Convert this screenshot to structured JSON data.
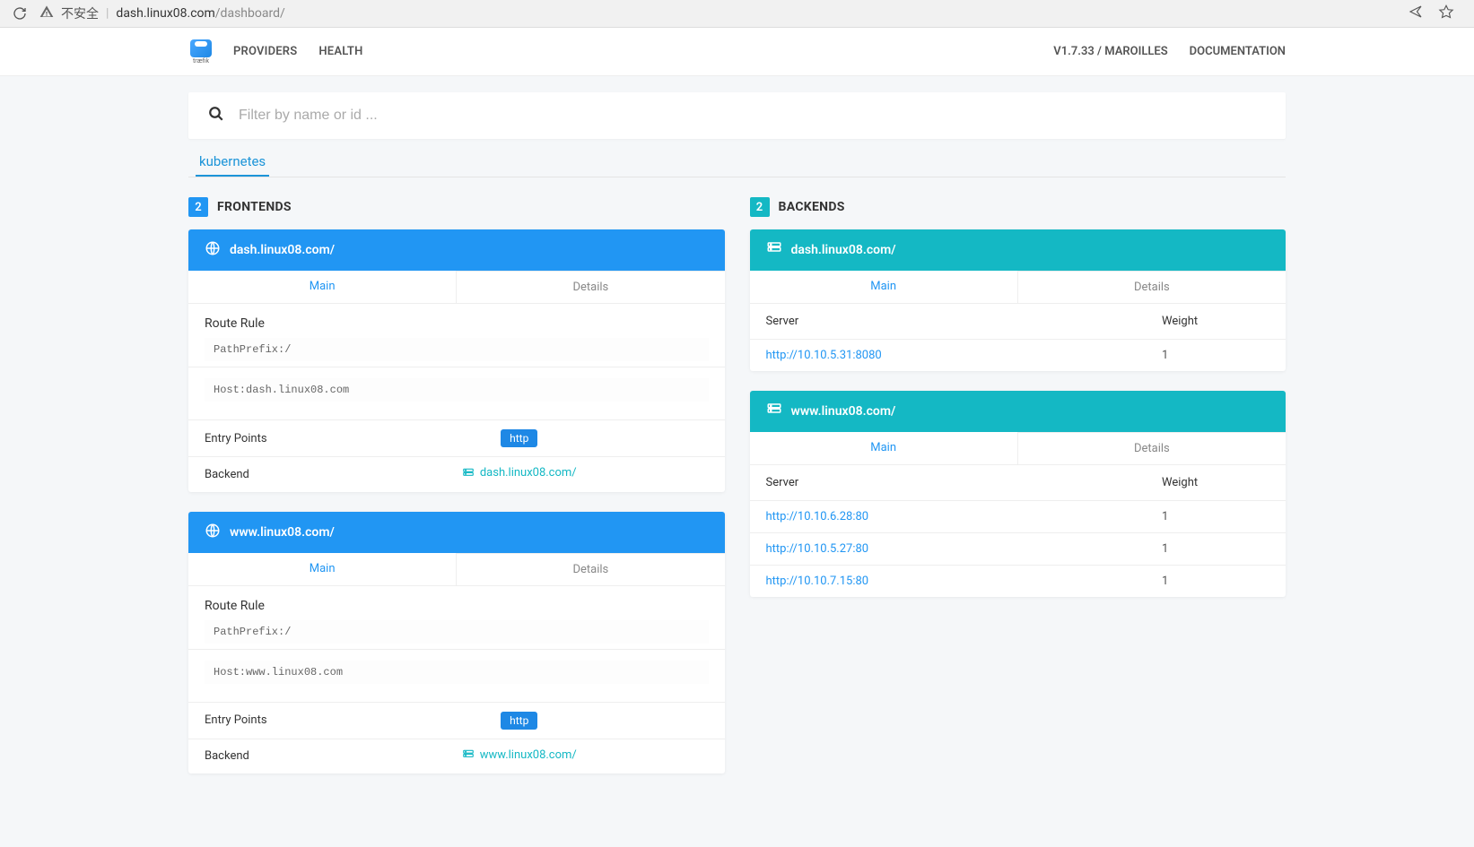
{
  "browser": {
    "insecure_label": "不安全",
    "url_host": "dash.linux08.com",
    "url_path": "/dashboard/"
  },
  "nav": {
    "logo_text": "træfik",
    "links": {
      "providers": "PROVIDERS",
      "health": "HEALTH"
    },
    "version": "V1.7.33 / MAROILLES",
    "docs": "DOCUMENTATION"
  },
  "search": {
    "placeholder": "Filter by name or id ..."
  },
  "provider_tabs": {
    "active": "kubernetes"
  },
  "frontends": {
    "count": "2",
    "title": "FRONTENDS",
    "tabs": {
      "main": "Main",
      "details": "Details"
    },
    "labels": {
      "route_rule": "Route Rule",
      "entry_points": "Entry Points",
      "backend": "Backend"
    },
    "items": [
      {
        "title": "dash.linux08.com/",
        "rule1": "PathPrefix:/",
        "rule2": "Host:dash.linux08.com",
        "entry_point": "http",
        "backend": "dash.linux08.com/"
      },
      {
        "title": "www.linux08.com/",
        "rule1": "PathPrefix:/",
        "rule2": "Host:www.linux08.com",
        "entry_point": "http",
        "backend": "www.linux08.com/"
      }
    ]
  },
  "backends": {
    "count": "2",
    "title": "BACKENDS",
    "tabs": {
      "main": "Main",
      "details": "Details"
    },
    "labels": {
      "server": "Server",
      "weight": "Weight"
    },
    "items": [
      {
        "title": "dash.linux08.com/",
        "servers": [
          {
            "url": "http://10.10.5.31:8080",
            "weight": "1"
          }
        ]
      },
      {
        "title": "www.linux08.com/",
        "servers": [
          {
            "url": "http://10.10.6.28:80",
            "weight": "1"
          },
          {
            "url": "http://10.10.5.27:80",
            "weight": "1"
          },
          {
            "url": "http://10.10.7.15:80",
            "weight": "1"
          }
        ]
      }
    ]
  }
}
